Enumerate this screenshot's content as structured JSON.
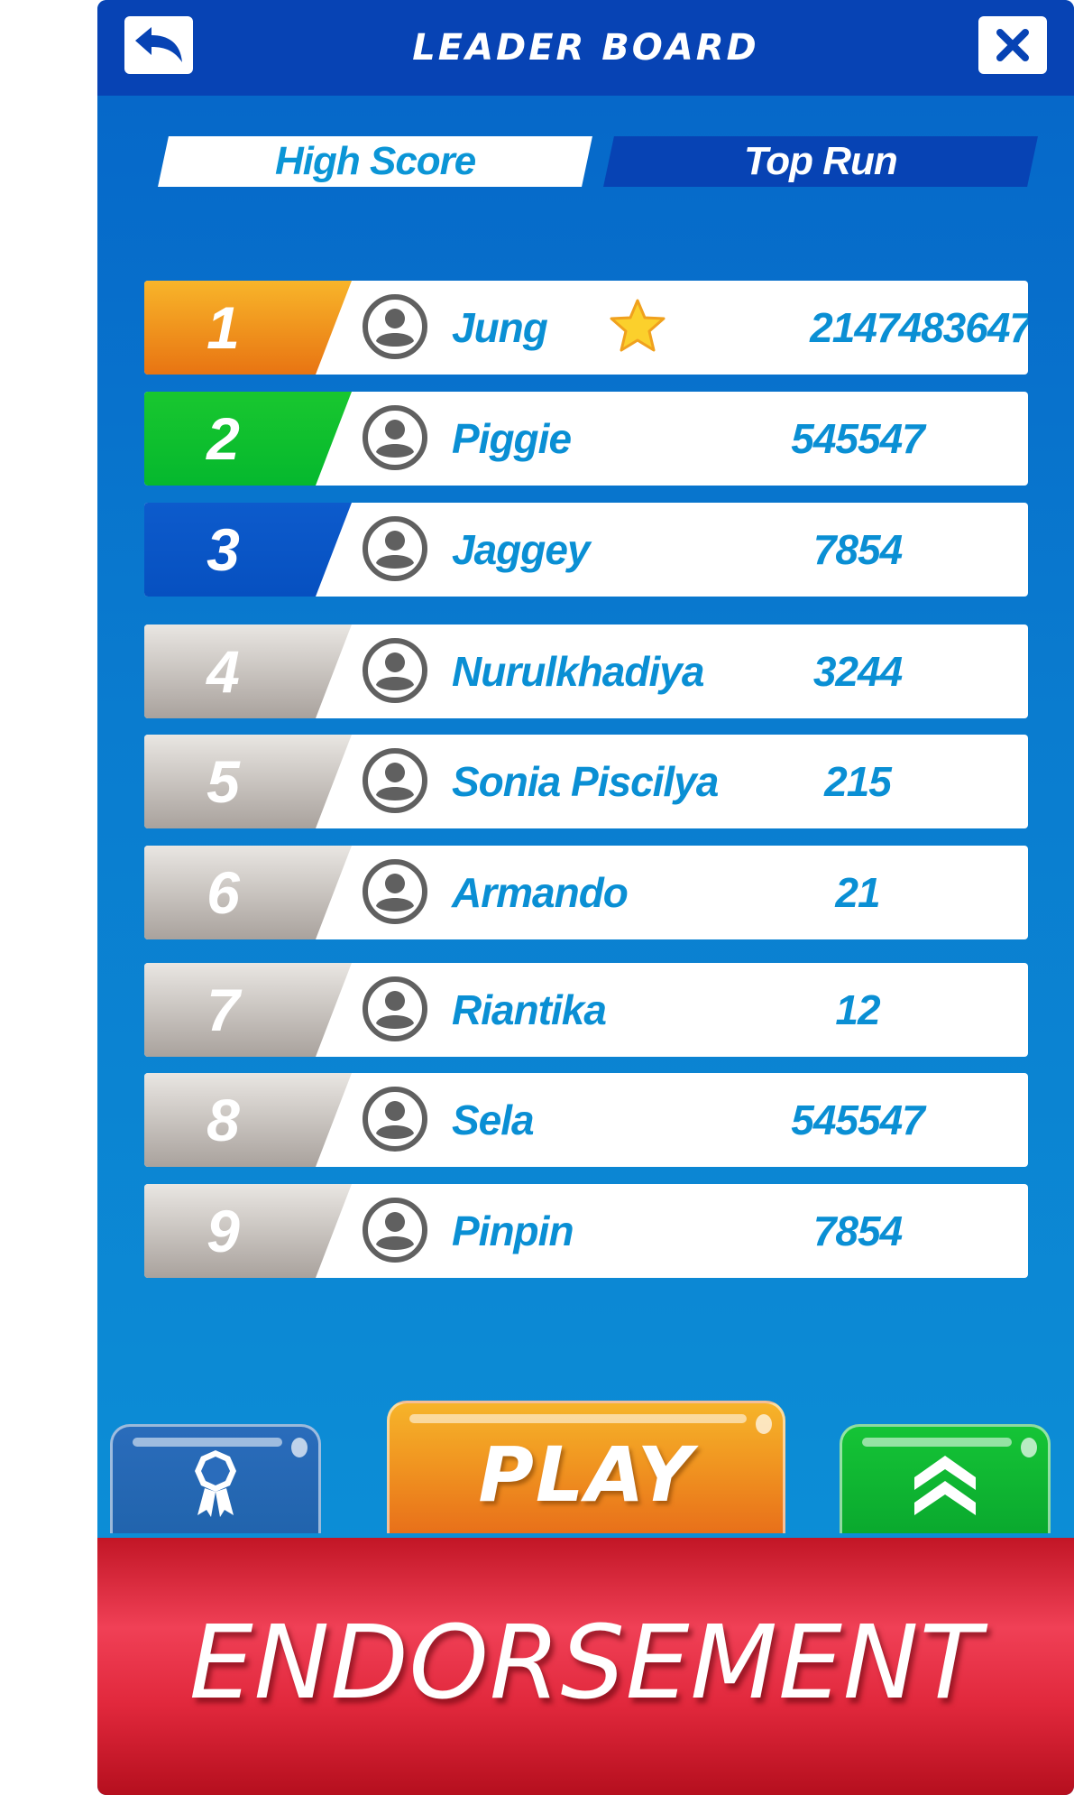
{
  "header": {
    "title": "LEADER BOARD",
    "back_icon": "back-arrow-icon",
    "close_icon": "close-icon"
  },
  "tabs": [
    {
      "label": "High Score",
      "active": true
    },
    {
      "label": "Top Run",
      "active": false
    }
  ],
  "leaderboard": {
    "rows": [
      {
        "rank": "1",
        "name": "Jung",
        "score": "2147483647",
        "badge": "star-icon",
        "rank_color": "#f39a1f"
      },
      {
        "rank": "2",
        "name": "Piggie",
        "score": "545547",
        "rank_color": "#0fc12e"
      },
      {
        "rank": "3",
        "name": "Jaggey",
        "score": "7854",
        "rank_color": "#0b57c8"
      },
      {
        "rank": "4",
        "name": "Nurulkhadiya",
        "score": "3244",
        "rank_color": "#bdb7b2"
      },
      {
        "rank": "5",
        "name": "Sonia Piscilya",
        "score": "215",
        "rank_color": "#bdb7b2"
      },
      {
        "rank": "6",
        "name": "Armando",
        "score": "21",
        "rank_color": "#bdb7b2"
      },
      {
        "rank": "7",
        "name": "Riantika",
        "score": "12",
        "rank_color": "#bdb7b2"
      },
      {
        "rank": "8",
        "name": "Sela",
        "score": "545547",
        "rank_color": "#bdb7b2"
      },
      {
        "rank": "9",
        "name": "Pinpin",
        "score": "7854",
        "rank_color": "#bdb7b2"
      }
    ]
  },
  "buttons": {
    "achievements_icon": "award-ribbon-icon",
    "play_label": "PLAY",
    "upgrade_icon": "double-chevron-up-icon"
  },
  "banner": {
    "text": "ENDORSEMENT"
  },
  "colors": {
    "header": "#0743b4",
    "panel": "#0a7ccf",
    "accent_text": "#0a8fd4",
    "play": "#f09320",
    "upgrade": "#0aa92e",
    "banner": "#e1283c"
  }
}
